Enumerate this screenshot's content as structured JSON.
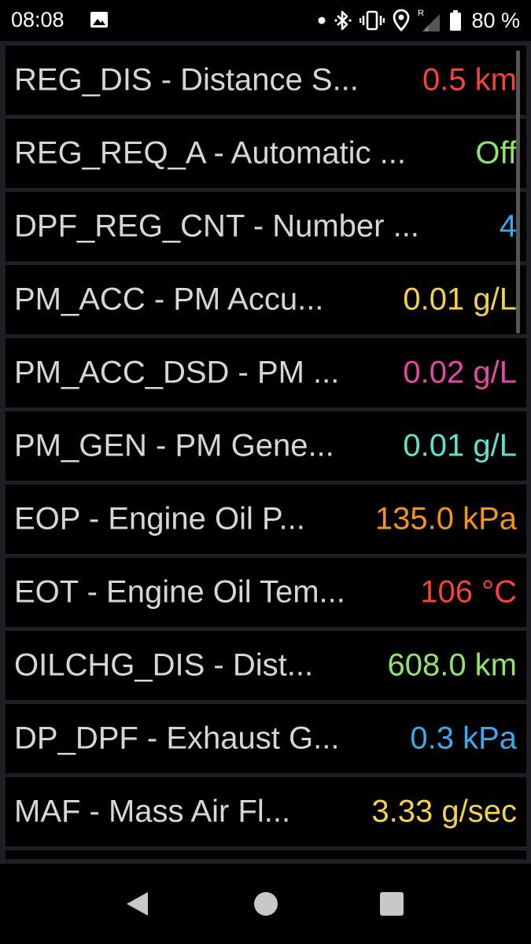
{
  "status": {
    "time": "08:08",
    "battery": "80 %",
    "icons": [
      "image-icon",
      "dot-icon",
      "bluetooth-icon",
      "vibrate-icon",
      "location-icon",
      "signal-icon",
      "battery-icon"
    ],
    "signal_label": "R"
  },
  "rows": [
    {
      "label": "REG_DIS - Distance S...",
      "value": "0.5 km",
      "color": "#f4433a"
    },
    {
      "label": "REG_REQ_A - Automatic ...",
      "value": "Off",
      "color": "#8ee66a"
    },
    {
      "label": "DPF_REG_CNT - Number ...",
      "value": "4",
      "color": "#3ea9ea"
    },
    {
      "label": "PM_ACC - PM Accu...",
      "value": "0.01 g/L",
      "color": "#f5cf4f"
    },
    {
      "label": "PM_ACC_DSD - PM ...",
      "value": "0.02 g/L",
      "color": "#e34aa5"
    },
    {
      "label": "PM_GEN - PM Gene...",
      "value": "0.01 g/L",
      "color": "#5fe3cd"
    },
    {
      "label": "EOP - Engine Oil P...",
      "value": "135.0 kPa",
      "color": "#f5931f"
    },
    {
      "label": "EOT - Engine Oil Tem...",
      "value": "106 °C",
      "color": "#f4433a"
    },
    {
      "label": "OILCHG_DIS - Dist...",
      "value": "608.0 km",
      "color": "#8ee66a"
    },
    {
      "label": "DP_DPF - Exhaust G...",
      "value": "0.3 kPa",
      "color": "#3ea9ea"
    },
    {
      "label": "MAF - Mass Air Fl...",
      "value": "3.33 g/sec",
      "color": "#f5cf4f"
    }
  ],
  "nav": {
    "icons": [
      "back-icon",
      "home-icon",
      "recent-apps-icon"
    ]
  }
}
